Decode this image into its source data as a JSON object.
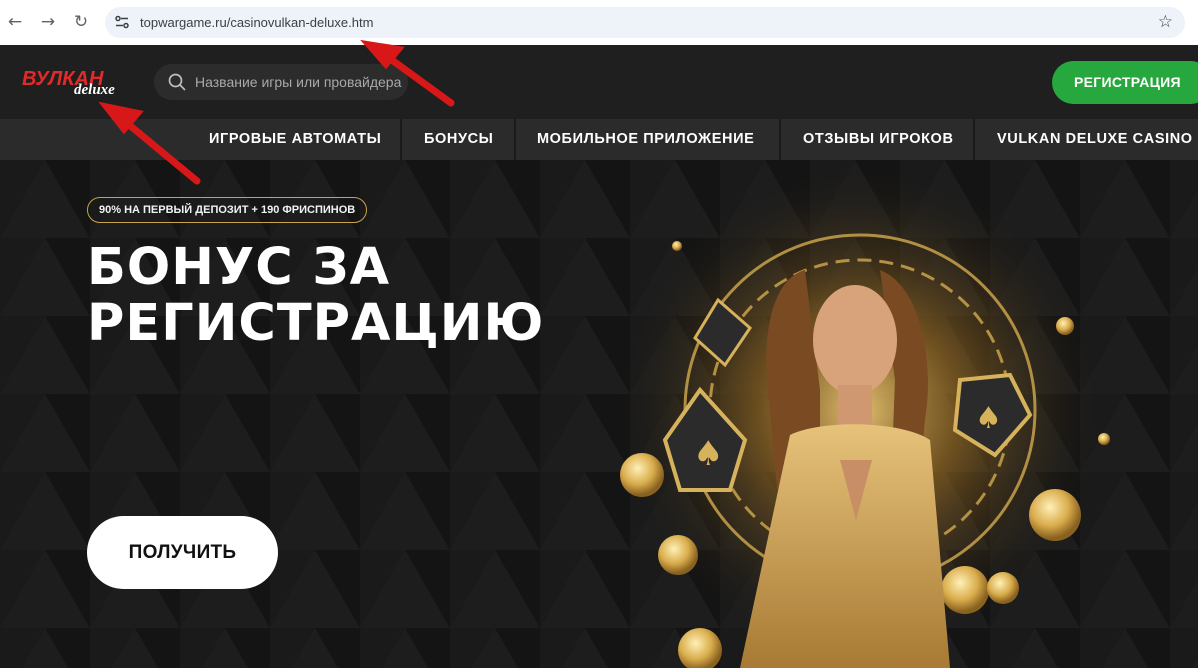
{
  "browser": {
    "url": "topwargame.ru/casinovulkan-deluxe.htm",
    "back_glyph": "←",
    "forward_glyph": "→",
    "reload_glyph": "↻",
    "star_glyph": "☆"
  },
  "header": {
    "logo_main": "ВУЛКАН",
    "logo_sub": "deluxe",
    "search_placeholder": "Название игры или провайдера",
    "register_label": "РЕГИСТРАЦИЯ"
  },
  "menu": {
    "items": [
      {
        "label": "ИГРОВЫЕ АВТОМАТЫ"
      },
      {
        "label": "БОНУСЫ"
      },
      {
        "label": "МОБИЛЬНОЕ ПРИЛОЖЕНИЕ"
      },
      {
        "label": "ОТЗЫВЫ ИГРОКОВ"
      },
      {
        "label": "VULKAN DELUXE CASINO"
      }
    ]
  },
  "hero": {
    "badge": "90% НА ПЕРВЫЙ ДЕПОЗИТ + 190 ФРИСПИНОВ",
    "title_line1": "БОНУС ЗА",
    "title_line2": "РЕГИСТРАЦИЮ",
    "cta_label": "ПОЛУЧИТЬ"
  },
  "colors": {
    "accent_green": "#27a83e",
    "logo_red": "#e12a2a",
    "gold": "#c9a24a",
    "annotation_red": "#d81818"
  }
}
